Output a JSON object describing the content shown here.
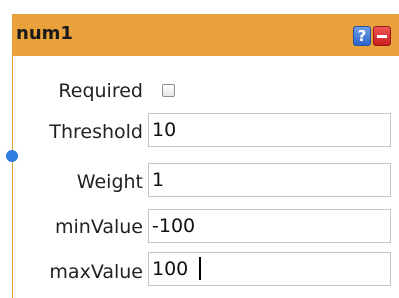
{
  "node": {
    "title": "num1",
    "help_symbol": "?",
    "fields": {
      "required": {
        "label": "Required",
        "checked": false
      },
      "threshold": {
        "label": "Threshold",
        "value": "10"
      },
      "weight": {
        "label": "Weight",
        "value": "1"
      },
      "min_value": {
        "label": "minValue",
        "value": "-100"
      },
      "max_value": {
        "label": "maxValue",
        "value": "100"
      }
    }
  },
  "colors": {
    "header": "#e8a13b",
    "help_button": "#2f64c9",
    "close_button": "#c81e1e",
    "port": "#2f7de0"
  },
  "icons": {
    "help": "help-icon",
    "close": "close-icon"
  }
}
